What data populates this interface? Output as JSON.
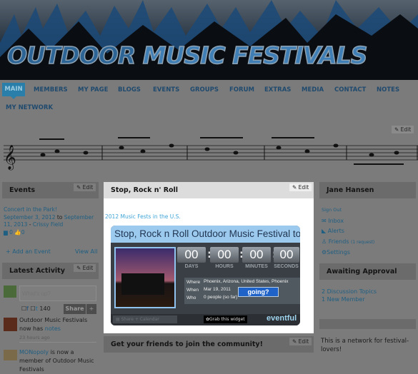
{
  "site": {
    "title_part1": "OUTDOOR",
    "title_part2": "MUSIC FESTIVALS"
  },
  "nav": {
    "items": [
      "MAIN",
      "MEMBERS",
      "MY PAGE",
      "BLOGS",
      "EVENTS",
      "GROUPS",
      "FORUM",
      "EXTRAS",
      "MEDIA",
      "CONTACT",
      "NOTES"
    ],
    "second_row": "MY NETWORK",
    "active": "MAIN"
  },
  "edit_label": "Edit",
  "events": {
    "title": "Events",
    "event_title": "Concert in the Park!",
    "start": "September 3, 2012",
    "to": "to",
    "end": "September 11, 2013",
    "location": "Crissy Field",
    "comments": "0",
    "likes": "0",
    "add": "+ Add an Event",
    "view_all": "View All"
  },
  "activity": {
    "title": "Latest Activity",
    "placeholder": "What's up?",
    "char_count": "140",
    "share": "Share",
    "plus": "+",
    "items": [
      {
        "text": "Outdoor Music Festivals now has",
        "link": "notes",
        "time": "23 hours ago"
      },
      {
        "link": "MONopoly",
        "text": "is now a member of Outdoor Music Festivals"
      }
    ]
  },
  "center": {
    "title": "Stop, Rock n' Roll",
    "link": "2012 Music Fests in the U.S.",
    "widget": {
      "title": "Stop, Rock n Roll Outdoor Music Festival to",
      "counters": [
        "00",
        "00",
        "00",
        "00"
      ],
      "labels": [
        "DAYS",
        "HOURS",
        "MINUTES",
        "SECONDS"
      ],
      "where_label": "Where",
      "where": "Phoenix, Arizona, United States, Phoenix",
      "when_label": "When",
      "when": "Mar 19, 2011",
      "who_label": "Who",
      "who": "0 people (so far)",
      "going": "going?",
      "share": "Share + Calendar",
      "grab": "Grab this widget",
      "brand": "eventful"
    },
    "invite_title": "Get your friends to join the community!"
  },
  "user": {
    "name": "Jane Hansen",
    "sign_out": "Sign Out",
    "links": [
      {
        "label": "Inbox",
        "icon": "envelope-icon"
      },
      {
        "label": "Alerts",
        "icon": "megaphone-icon"
      },
      {
        "label": "Friends",
        "extra": "(1 request)",
        "icon": "person-icon"
      },
      {
        "label": "Settings",
        "icon": "gear-icon"
      }
    ]
  },
  "approval": {
    "title": "Awaiting Approval",
    "items": [
      "2 Discussion Topics",
      "1 New Member"
    ]
  },
  "about": {
    "text": "This is a network for festival-lovers!"
  }
}
